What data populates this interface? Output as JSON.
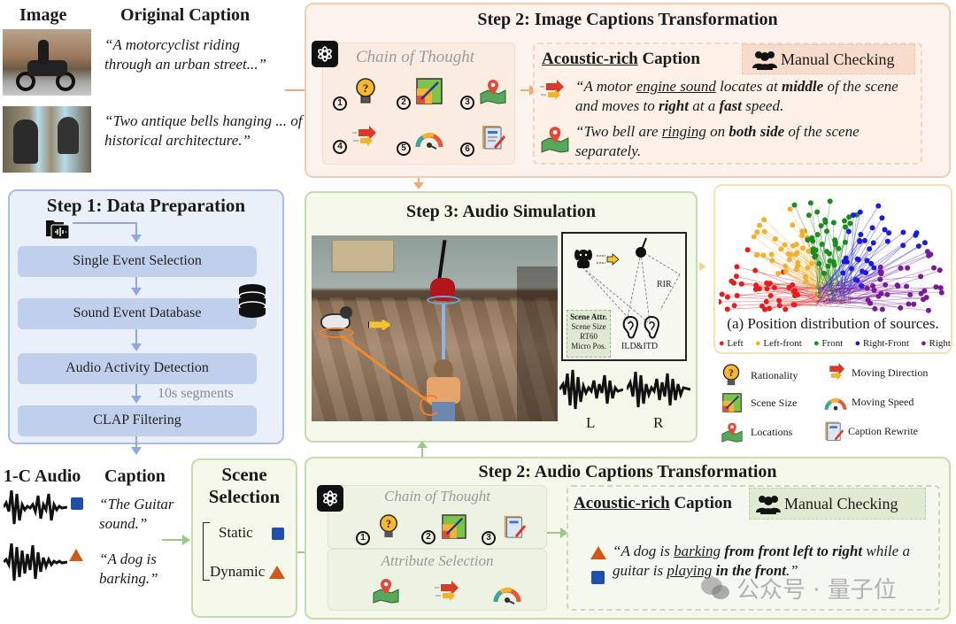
{
  "left_top": {
    "image_header": "Image",
    "caption_header": "Original Caption",
    "captions": [
      "“A motorcyclist riding through an urban street...”",
      "“Two antique bells hanging ... of historical architecture.”"
    ],
    "images": [
      "motorcycle-photo",
      "bells-photo"
    ]
  },
  "step2_image": {
    "title": "Step 2: Image Captions Transformation",
    "cot_label": "Chain of Thought",
    "cot_numbers": [
      "1",
      "2",
      "3",
      "4",
      "5",
      "6"
    ],
    "acoustic_title_u": "Acoustic-rich",
    "acoustic_title_rest": " Caption",
    "manual_checking": "Manual Checking",
    "caption1": {
      "p1": "“A motor ",
      "u1": "engine sound",
      "p2": " locates at ",
      "b1": "middle",
      "p3": " of the scene and  moves to ",
      "b2": "right",
      "p4": " at a ",
      "b3": "fast",
      "p5": " speed."
    },
    "caption2": {
      "p1": "“Two bell are ",
      "u1": "ringing",
      "p2": " on ",
      "b1": "both side",
      "p3": " of the scene separately."
    }
  },
  "step1": {
    "title": "Step 1: Data Preparation",
    "steps": [
      "Single Event Selection",
      "Sound Event Database",
      "Audio Activity Detection",
      "CLAP Filtering"
    ],
    "segment_note": "10s segments"
  },
  "step3": {
    "title": "Step 3: Audio Simulation",
    "rir_label": "RIR",
    "scene_attr_title": "Scene Attr.",
    "scene_attrs": [
      "Scene Size",
      "RT60",
      "Micro Pos."
    ],
    "ild_itd": "ILD&ITD",
    "channel_left": "L",
    "channel_right": "R"
  },
  "position_chart": {
    "caption": "(a) Position distribution of sources.",
    "legend": [
      {
        "label": "Left",
        "color": "#e81c1c"
      },
      {
        "label": "Left-front",
        "color": "#f0b030"
      },
      {
        "label": "Front",
        "color": "#1f8a1f"
      },
      {
        "label": "Right-Front",
        "color": "#1a1ae0"
      },
      {
        "label": "Right",
        "color": "#7a1a9a"
      }
    ]
  },
  "icon_legend": [
    {
      "icon": "lightbulb-question-icon",
      "label": "Rationality"
    },
    {
      "icon": "moving-direction-icon",
      "label": "Moving Direction"
    },
    {
      "icon": "scene-size-icon",
      "label": "Scene Size"
    },
    {
      "icon": "speedometer-icon",
      "label": "Moving Speed"
    },
    {
      "icon": "map-pin-icon",
      "label": "Locations"
    },
    {
      "icon": "document-pencil-icon",
      "label": "Caption Rewrite"
    }
  ],
  "bottom_left": {
    "audio_header": "1-C Audio",
    "caption_header": "Caption",
    "captions": [
      "“The Guitar sound.”",
      "“A dog is barking.”"
    ]
  },
  "scene_selection": {
    "title_line1": "Scene",
    "title_line2": "Selection",
    "static": "Static",
    "dynamic": "Dynamic"
  },
  "step2_audio": {
    "title": "Step 2: Audio Captions Transformation",
    "cot_label": "Chain of Thought",
    "cot_numbers": [
      "1",
      "2",
      "3"
    ],
    "attr_label": "Attribute Selection",
    "acoustic_title_u": "Acoustic-rich",
    "acoustic_title_rest": " Caption",
    "manual_checking": "Manual Checking",
    "caption": {
      "p1": "“A dog is ",
      "u1": "barking",
      "b1": " from front left to right",
      "p2": " while a guitar is ",
      "u2": "playing",
      "b2": " in the front",
      "p3": ".”"
    }
  },
  "watermark": "公众号 · 量子位",
  "colors": {
    "orange_accent": "#f0a878",
    "green_accent": "#9cc98a",
    "blue_accent": "#8fa9dd",
    "static_square": "#1f4fa8",
    "dynamic_triangle": "#d0581a"
  }
}
